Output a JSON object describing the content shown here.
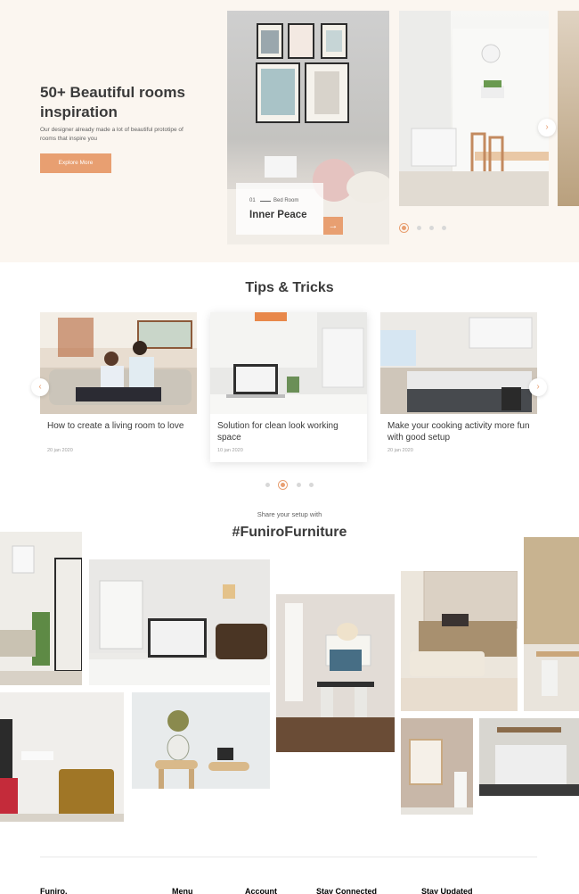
{
  "hero": {
    "title": "50+ Beautiful rooms inspiration",
    "description": "Our designer already made a lot of beautiful prototipe of rooms that inspire you",
    "button_label": "Explore More",
    "active_slide": {
      "number": "01",
      "category": "Bed Room",
      "name": "Inner Peace"
    },
    "arrow_icon": "→",
    "next_icon": "›",
    "slide_count": 4,
    "active_index": 0
  },
  "tips": {
    "title": "Tips & Tricks",
    "prev_icon": "‹",
    "next_icon": "›",
    "cards": [
      {
        "title": "How to create a living room to love",
        "date": "20 jan 2020"
      },
      {
        "title": "Solution for clean look working space",
        "date": "10 jan 2020"
      },
      {
        "title": "Make your cooking activity more fun with good setup",
        "date": "20 jan 2020"
      }
    ],
    "dot_count": 4,
    "active_dot": 1
  },
  "share": {
    "subtitle": "Share your setup with",
    "hashtag": "#FuniroFurniture"
  },
  "footer": {
    "columns": [
      "Funiro.",
      "Menu",
      "Account",
      "Stay Connected",
      "Stay Updated"
    ]
  },
  "colors": {
    "accent": "#e89f71",
    "hero_bg": "#fbf6f0",
    "text_dark": "#3a3a3a",
    "text_muted": "#616161"
  }
}
